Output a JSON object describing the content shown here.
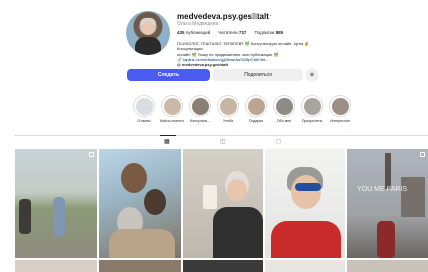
{
  "profile": {
    "username": "medvedeva.psy.geshtalt",
    "more_icon": "ellipsis-icon",
    "full_name": "Ольга Медведева",
    "stats": [
      {
        "value": "435",
        "label": "публикаций"
      },
      {
        "value": "737",
        "label": "Читатели"
      },
      {
        "value": "885",
        "label": "Подписки"
      }
    ],
    "bio": {
      "line1": "ПСИХОЛОГ, ГЕШТАЛЬТ-ТЕРАПЕВТ 🌿 Консультирую онлайн. Цена 💰 Консультации",
      "line2": "",
      "line3": "онлайн 🌿 Пишу по продвижению. мои публикации 🌿",
      "link": "🔗 taplink.cc/meditation/ggl3ewhAuSiI3tpCWfr3bt...",
      "handle": "@ medvedeva.psy.geshtalt"
    }
  },
  "actions": {
    "follow_label": "Следить",
    "message_label": "Поделиться",
    "suggest_label": "⊕"
  },
  "highlights": [
    {
      "label": "Отзывы",
      "color": "#d9dde3"
    },
    {
      "label": "Кейсы клиента...",
      "color": "#c9b9a6"
    },
    {
      "label": "Консульта...",
      "color": "#8a7f73"
    },
    {
      "label": "Учеба",
      "color": "#c6b5a2"
    },
    {
      "label": "Подарки",
      "color": "#b9a592"
    },
    {
      "label": "Обо мне",
      "color": "#8e8a84"
    },
    {
      "label": "Приоритеты",
      "color": "#a9a49d"
    },
    {
      "label": "Интересное",
      "color": "#9a9088"
    }
  ],
  "tabs": {
    "posts_icon": "grid-icon",
    "reels_icon": "reels-icon",
    "tagged_icon": "tagged-icon"
  },
  "posts": [
    {
      "overlay": ""
    },
    {
      "overlay": ""
    },
    {
      "overlay": ""
    },
    {
      "overlay": ""
    },
    {
      "overlay": "YOU ME PARIS"
    }
  ],
  "colors": {
    "accent": "#4a5cf0",
    "secondary_button": "#efefef",
    "divider": "#dbdbdb"
  }
}
